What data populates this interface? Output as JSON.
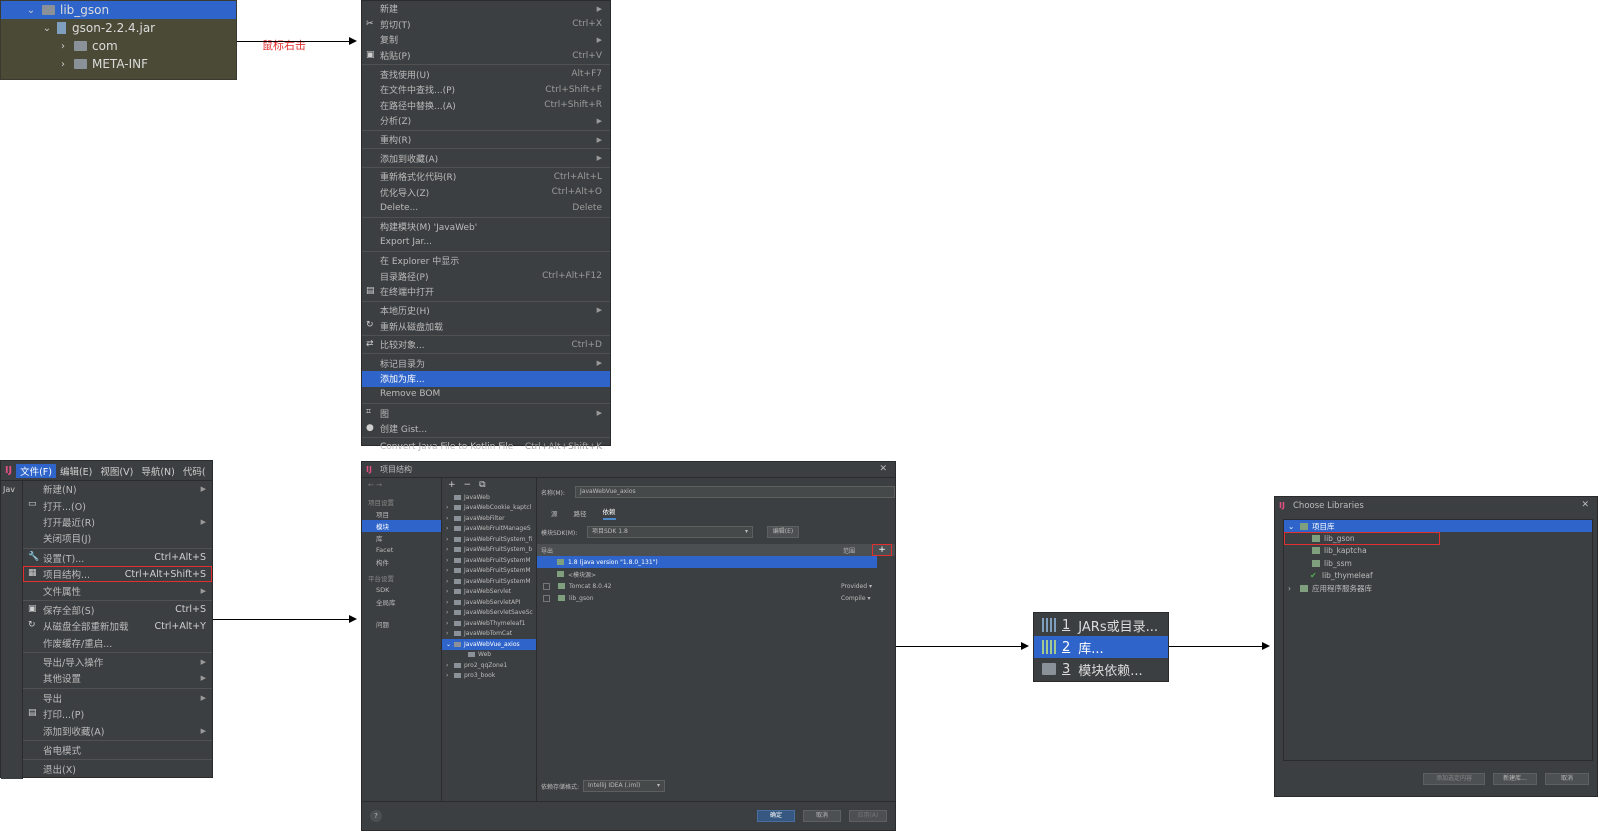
{
  "tree": {
    "items": [
      {
        "label": "lib_gson"
      },
      {
        "label": "gson-2.2.4.jar"
      },
      {
        "label": "com"
      },
      {
        "label": "META-INF"
      }
    ]
  },
  "note": "鼠标右击",
  "context_menu": {
    "items": [
      {
        "label": "新建",
        "shortcut": "",
        "submenu": true
      },
      {
        "label": "剪切(T)",
        "shortcut": "Ctrl+X",
        "icon": "✂"
      },
      {
        "label": "复制",
        "shortcut": "",
        "submenu": true
      },
      {
        "label": "粘贴(P)",
        "shortcut": "Ctrl+V",
        "icon": "▣"
      },
      {
        "sep": true
      },
      {
        "label": "查找使用(U)",
        "shortcut": "Alt+F7"
      },
      {
        "label": "在文件中查找...(P)",
        "shortcut": "Ctrl+Shift+F"
      },
      {
        "label": "在路径中替换...(A)",
        "shortcut": "Ctrl+Shift+R"
      },
      {
        "label": "分析(Z)",
        "shortcut": "",
        "submenu": true
      },
      {
        "sep": true
      },
      {
        "label": "重构(R)",
        "shortcut": "",
        "submenu": true
      },
      {
        "sep": true
      },
      {
        "label": "添加到收藏(A)",
        "shortcut": "",
        "submenu": true
      },
      {
        "sep": true
      },
      {
        "label": "重新格式化代码(R)",
        "shortcut": "Ctrl+Alt+L"
      },
      {
        "label": "优化导入(Z)",
        "shortcut": "Ctrl+Alt+O"
      },
      {
        "label": "Delete...",
        "shortcut": "Delete"
      },
      {
        "sep": true
      },
      {
        "label": "构建模块(M) 'JavaWeb'",
        "shortcut": ""
      },
      {
        "label": "Export Jar...",
        "shortcut": ""
      },
      {
        "sep": true
      },
      {
        "label": "在 Explorer 中显示",
        "shortcut": ""
      },
      {
        "label": "目录路径(P)",
        "shortcut": "Ctrl+Alt+F12"
      },
      {
        "label": "在终端中打开",
        "shortcut": "",
        "icon": "▤"
      },
      {
        "sep": true
      },
      {
        "label": "本地历史(H)",
        "shortcut": "",
        "submenu": true
      },
      {
        "label": "重新从磁盘加载",
        "shortcut": "",
        "icon": "↻"
      },
      {
        "sep": true
      },
      {
        "label": "比较对象...",
        "shortcut": "Ctrl+D",
        "icon": "⇄"
      },
      {
        "sep": true
      },
      {
        "label": "标记目录为",
        "shortcut": "",
        "submenu": true
      },
      {
        "label": "添加为库...",
        "shortcut": "",
        "highlight": true
      },
      {
        "label": "Remove BOM",
        "shortcut": ""
      },
      {
        "sep": true
      },
      {
        "label": "图",
        "shortcut": "",
        "submenu": true,
        "icon": "⌗"
      },
      {
        "label": "创建 Gist...",
        "shortcut": "",
        "icon": "●"
      },
      {
        "sep": true
      },
      {
        "label": "Convert Java File to Kotlin File",
        "shortcut": "Ctrl+Alt+Shift+K"
      }
    ]
  },
  "file_menu": {
    "menubar": [
      "文件(F)",
      "编辑(E)",
      "视图(V)",
      "导航(N)",
      "代码("
    ],
    "side_label": "Jav",
    "items": [
      {
        "label": "新建(N)",
        "shortcut": "",
        "submenu": true
      },
      {
        "label": "打开...(O)",
        "shortcut": "",
        "icon": "▭"
      },
      {
        "label": "打开最近(R)",
        "shortcut": "",
        "submenu": true
      },
      {
        "label": "关闭项目(J)",
        "shortcut": ""
      },
      {
        "sep": true
      },
      {
        "label": "设置(T)...",
        "shortcut": "Ctrl+Alt+S",
        "icon": "🔧"
      },
      {
        "label": "项目结构...",
        "shortcut": "Ctrl+Alt+Shift+S",
        "icon": "▦",
        "boxed": true
      },
      {
        "label": "文件属性",
        "shortcut": "",
        "submenu": true
      },
      {
        "sep": true
      },
      {
        "label": "保存全部(S)",
        "shortcut": "Ctrl+S",
        "icon": "▣"
      },
      {
        "label": "从磁盘全部重新加载",
        "shortcut": "Ctrl+Alt+Y",
        "icon": "↻"
      },
      {
        "label": "作废缓存/重启...",
        "shortcut": ""
      },
      {
        "sep": true
      },
      {
        "label": "导出/导入操作",
        "shortcut": "",
        "submenu": true
      },
      {
        "label": "其他设置",
        "shortcut": "",
        "submenu": true
      },
      {
        "sep": true
      },
      {
        "label": "导出",
        "shortcut": "",
        "submenu": true
      },
      {
        "label": "打印...(P)",
        "shortcut": "",
        "icon": "▤"
      },
      {
        "label": "添加到收藏(A)",
        "shortcut": "",
        "submenu": true
      },
      {
        "sep": true
      },
      {
        "label": "省电模式",
        "shortcut": ""
      },
      {
        "sep": true
      },
      {
        "label": "退出(X)",
        "shortcut": ""
      }
    ]
  },
  "project_structure": {
    "title": "项目结构",
    "left": {
      "groups": [
        {
          "title": "项目设置",
          "items": [
            "项目",
            "模块",
            "库",
            "Facet",
            "构件"
          ]
        },
        {
          "title": "平台设置",
          "items": [
            "SDK",
            "全局库"
          ]
        },
        {
          "title": "",
          "items": [
            "问题"
          ]
        }
      ],
      "selected": "模块"
    },
    "modules": [
      "JavaWeb",
      "JavaWebCookie_kaptcl",
      "JavaWebFilter",
      "JavaWebFruitManageS",
      "JavaWebFruitSystem_fi",
      "JavaWebFruitSystem_b",
      "JavaWebFruitSystemM",
      "JavaWebFruitSystemM",
      "JavaWebFruitSystemM",
      "JavaWebServlet",
      "JavaWebServletAPI",
      "JavaWebServletSaveSc",
      "JavaWebThymeleaf1",
      "JavaWebTomCat",
      "JavaWebVue_axios",
      "Web",
      "pro2_qqZone1",
      "pro3_book"
    ],
    "selected_module": "JavaWebVue_axios",
    "name_label": "名称(M):",
    "name_value": "JavaWebVue_axios",
    "tabs": [
      "源",
      "路径",
      "依赖"
    ],
    "active_tab": "依赖",
    "sdk_label": "模块SDK(M):",
    "sdk_value": "项目SDK 1.8",
    "edit_btn": "编辑(E)",
    "table_head": {
      "col1": "导出",
      "col2": "范围"
    },
    "deps": [
      {
        "label": "1.8 (java version \"1.8.0_131\")",
        "scope": "",
        "selected": true
      },
      {
        "label": "<模块源>",
        "scope": ""
      },
      {
        "label": "Tomcat 8.0.42",
        "scope": "Provided ▾"
      },
      {
        "label": "lib_gson",
        "scope": "Compile ▾"
      }
    ],
    "storage_label": "依赖存储格式:",
    "storage_value": "IntelliJ IDEA (.iml)",
    "buttons": {
      "ok": "确定",
      "cancel": "取消",
      "apply": "应用(A)"
    },
    "help": "?"
  },
  "popup": {
    "items": [
      {
        "num": "1",
        "label": "JARs或目录..."
      },
      {
        "num": "2",
        "label": "库...",
        "selected": true
      },
      {
        "num": "3",
        "label": "模块依赖..."
      }
    ]
  },
  "choose_libraries": {
    "title": "Choose Libraries",
    "group": "项目库",
    "items": [
      "lib_gson",
      "lib_kaptcha",
      "lib_ssm",
      "lib_thymeleaf"
    ],
    "group2": "应用程序服务器库",
    "buttons": {
      "add": "添加选定内容",
      "new": "新建库...",
      "cancel": "取消"
    }
  },
  "colors": {
    "accent": "#2f65ca",
    "highlight_box": "#e03030",
    "panel": "#3c3f41"
  }
}
